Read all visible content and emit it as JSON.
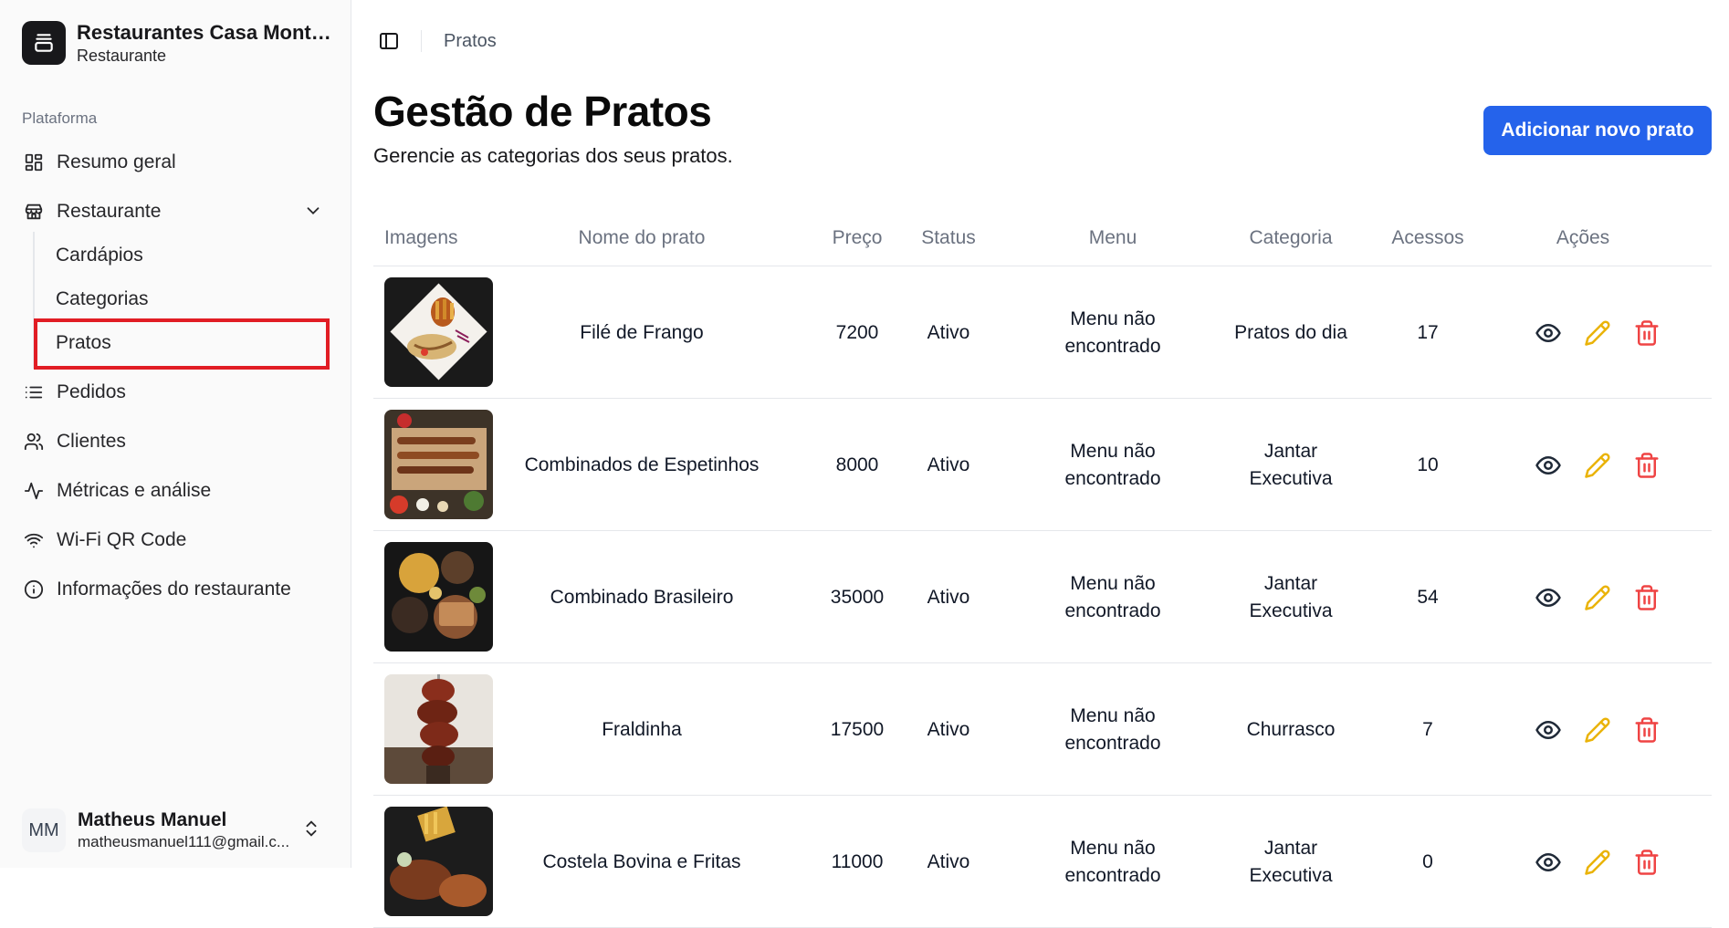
{
  "sidebar": {
    "brand_name": "Restaurantes Casa Monte...",
    "brand_sub": "Restaurante",
    "section_label": "Plataforma",
    "nav": {
      "overview": "Resumo geral",
      "restaurant": "Restaurante",
      "cardapios": "Cardápios",
      "categorias": "Categorias",
      "pratos": "Pratos",
      "pedidos": "Pedidos",
      "clientes": "Clientes",
      "metricas": "Métricas e análise",
      "wifi": "Wi-Fi QR Code",
      "info": "Informações do restaurante"
    },
    "user": {
      "initials": "MM",
      "name": "Matheus Manuel",
      "email": "matheusmanuel111@gmail.c..."
    }
  },
  "breadcrumb": "Pratos",
  "page": {
    "title": "Gestão de Pratos",
    "subtitle": "Gerencie as categorias dos seus pratos.",
    "add_button": "Adicionar novo prato"
  },
  "table": {
    "headers": [
      "Imagens",
      "Nome do prato",
      "Preço",
      "Status",
      "Menu",
      "Categoria",
      "Acessos",
      "Ações"
    ],
    "rows": [
      {
        "name": "Filé de Frango",
        "price": "7200",
        "status": "Ativo",
        "menu": [
          "Menu não",
          "encontrado"
        ],
        "category": [
          "Pratos do dia"
        ],
        "access": "17"
      },
      {
        "name": "Combinados de Espetinhos",
        "price": "8000",
        "status": "Ativo",
        "menu": [
          "Menu não",
          "encontrado"
        ],
        "category": [
          "Jantar",
          "Executiva"
        ],
        "access": "10"
      },
      {
        "name": "Combinado Brasileiro",
        "price": "35000",
        "status": "Ativo",
        "menu": [
          "Menu não",
          "encontrado"
        ],
        "category": [
          "Jantar",
          "Executiva"
        ],
        "access": "54"
      },
      {
        "name": "Fraldinha",
        "price": "17500",
        "status": "Ativo",
        "menu": [
          "Menu não",
          "encontrado"
        ],
        "category": [
          "Churrasco"
        ],
        "access": "7"
      },
      {
        "name": "Costela Bovina e Fritas",
        "price": "11000",
        "status": "Ativo",
        "menu": [
          "Menu não",
          "encontrado"
        ],
        "category": [
          "Jantar",
          "Executiva"
        ],
        "access": "0"
      }
    ]
  },
  "colors": {
    "accent": "#2563eb",
    "highlight": "#e11d24",
    "edit": "#eab308",
    "delete": "#ef4444"
  },
  "icons": {
    "view": "eye-icon",
    "edit": "pencil-icon",
    "delete": "trash-icon"
  }
}
